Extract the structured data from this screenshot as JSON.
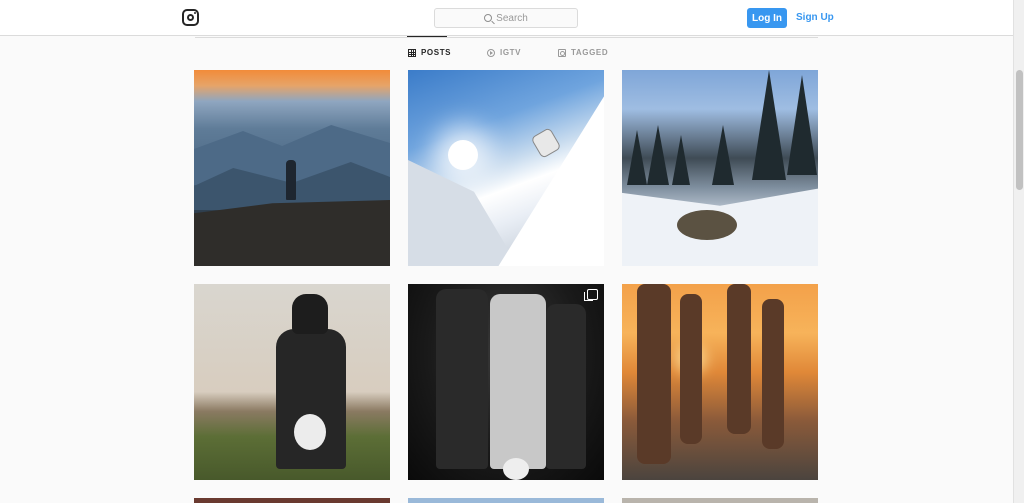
{
  "header": {
    "search_placeholder": "Search",
    "login_label": "Log In",
    "signup_label": "Sign Up",
    "accent_color": "#3897f0"
  },
  "tabs": [
    {
      "label": "POSTS",
      "icon": "grid-icon",
      "active": true
    },
    {
      "label": "IGTV",
      "icon": "igtv-icon",
      "active": false
    },
    {
      "label": "TAGGED",
      "icon": "tag-icon",
      "active": false
    }
  ],
  "posts": [
    {
      "subject": "hiker on mountain at sunset"
    },
    {
      "subject": "snowboarder jumping on snowy slope"
    },
    {
      "subject": "snowy pine forest with stream"
    },
    {
      "subject": "hooded person holding ball"
    },
    {
      "subject": "soccer players in black and white",
      "multi": true
    },
    {
      "subject": "horse legs at sunset"
    }
  ]
}
